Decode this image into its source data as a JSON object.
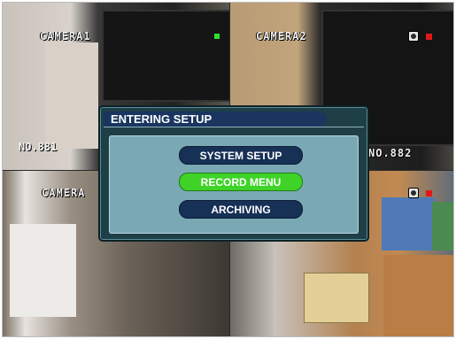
{
  "cameras": [
    {
      "label": "CAMERA1"
    },
    {
      "label": "CAMERA2"
    },
    {
      "label": "CAMERA"
    },
    {
      "label": "NO.882"
    }
  ],
  "overlay_text": {
    "q1_number": "NO.881"
  },
  "dialog": {
    "title": "ENTERING SETUP",
    "buttons": [
      {
        "label": "SYSTEM SETUP",
        "state": "normal"
      },
      {
        "label": "RECORD MENU",
        "state": "selected"
      },
      {
        "label": "ARCHIVING",
        "state": "normal"
      }
    ]
  },
  "colors": {
    "selected_button": "#3fd328",
    "normal_button": "#163056",
    "dialog_background": "#1f3f47",
    "panel_background": "#7aa9b4",
    "record_indicator": "#e21818",
    "status_indicator": "#2fe02f"
  },
  "icons": [
    "camera-status-icon",
    "record-indicator-icon"
  ]
}
